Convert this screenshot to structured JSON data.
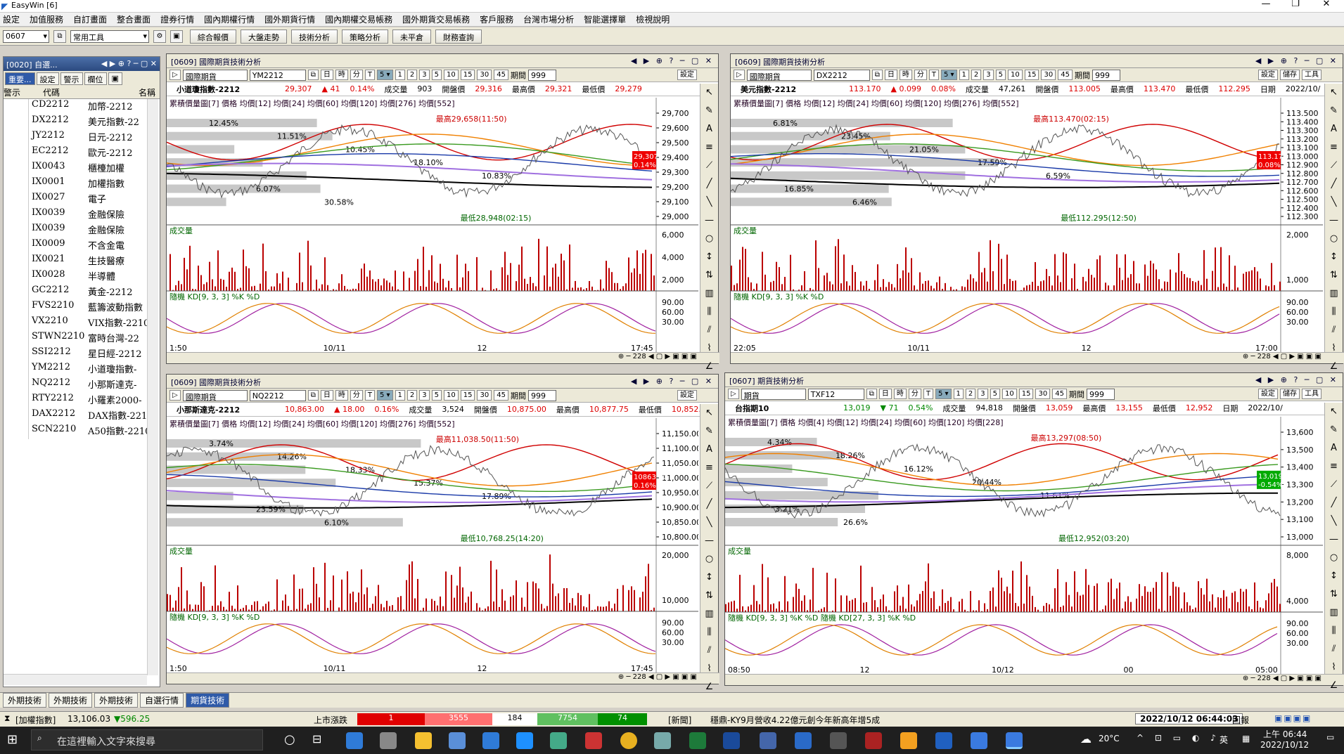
{
  "app": {
    "title": "EasyWin [6]"
  },
  "menu": [
    "設定",
    "加值服務",
    "自訂畫面",
    "整合畫面",
    "證券行情",
    "國內期權行情",
    "國外期貨行情",
    "國內期權交易帳務",
    "國外期貨交易帳務",
    "客戶服務",
    "台灣市場分析",
    "智能選擇單",
    "檢視說明"
  ],
  "toolbar": {
    "code": "0607",
    "layout": "常用工具",
    "buttons": [
      "綜合報價",
      "大盤走勢",
      "技術分析",
      "策略分析",
      "未平倉",
      "財務查詢"
    ]
  },
  "watchlist": {
    "title": "[0020] 自選...",
    "tabs": [
      "重要...",
      "設定",
      "警示",
      "欄位"
    ],
    "cols": [
      "警示",
      "代碼",
      "名稱"
    ],
    "rows": [
      [
        "CD2212",
        "加幣-2212"
      ],
      [
        "DX2212",
        "美元指數-22"
      ],
      [
        "JY2212",
        "日元-2212"
      ],
      [
        "EC2212",
        "歐元-2212"
      ],
      [
        "IX0043",
        "櫃檯加權"
      ],
      [
        "IX0001",
        "加權指數"
      ],
      [
        "IX0027",
        "電子"
      ],
      [
        "IX0039",
        "金融保險"
      ],
      [
        "IX0039",
        "金融保險"
      ],
      [
        "IX0009",
        "不含金電"
      ],
      [
        "IX0021",
        "生技醫療"
      ],
      [
        "IX0028",
        "半導體"
      ],
      [
        "GC2212",
        "黃金-2212"
      ],
      [
        "FVS2210",
        "藍籌波動指數"
      ],
      [
        "VX2210",
        "VIX指數-2210"
      ],
      [
        "STWN2210",
        "富時台灣-22"
      ],
      [
        "SSI2212",
        "星日經-2212"
      ],
      [
        "YM2212",
        "小道瓊指數-"
      ],
      [
        "NQ2212",
        "小那斯達克-"
      ],
      [
        "RTY2212",
        "小羅素2000-"
      ],
      [
        "DAX2212",
        "DAX指數-2212"
      ],
      [
        "SCN2210",
        "A50指數-2210"
      ]
    ]
  },
  "panels": [
    {
      "title": "[0609] 國際期貨技術分析",
      "market": "國際期貨",
      "code": "YM2212",
      "period": "999",
      "name": "小道瓊指數-2212",
      "price": "29,307",
      "chg": "▲ 41",
      "pct": "0.14%",
      "vol_label": "成交量",
      "vol": "903",
      "open_label": "開盤價",
      "open": "29,316",
      "high_label": "最高價",
      "high": "29,321",
      "low_label": "最低價",
      "low": "29,279",
      "legend": "累積價量圖[7] 價格 均價[12] 均價[24] 均價[60] 均價[120] 均價[276] 均價[552]",
      "yticks": [
        "29,700",
        "29,600",
        "29,500",
        "29,400",
        "29,300",
        "29,200",
        "29,100",
        "29,000"
      ],
      "hi": "最高29,658(11:50)",
      "lo": "最低28,948(02:15)",
      "last": "29,307",
      "lastpct": "0.14%",
      "pcts": [
        "12.45%",
        "11.51%",
        "10.45%",
        "18.10%",
        "10.83%",
        "6.07%",
        "30.58%"
      ],
      "volticks": [
        "6,000",
        "4,000",
        "2,000"
      ],
      "kd": "隨機 KD[9, 3, 3] %K %D",
      "kdticks": [
        "90.00",
        "60.00",
        "30.00"
      ],
      "xticks": [
        "1:50",
        "10/11",
        "12",
        "17:45"
      ],
      "zoom": "228"
    },
    {
      "title": "[0609] 國際期貨技術分析",
      "market": "國際期貨",
      "code": "DX2212",
      "period": "999",
      "name": "美元指數-2212",
      "price": "113.170",
      "chg": "▲ 0.099",
      "pct": "0.08%",
      "vol_label": "成交量",
      "vol": "47,261",
      "open_label": "開盤價",
      "open": "113.005",
      "high_label": "最高價",
      "high": "113.470",
      "low_label": "最低價",
      "low": "112.295",
      "legend": "累積價量圖[7] 價格 均價[12] 均價[24] 均價[60] 均價[120] 均價[276] 均價[552]",
      "yticks": [
        "113.500",
        "113.400",
        "113.300",
        "113.200",
        "113.100",
        "113.000",
        "112.900",
        "112.800",
        "112.700",
        "112.600",
        "112.500",
        "112.400",
        "112.300"
      ],
      "hi": "最高113.470(02:15)",
      "lo": "最低112.295(12:50)",
      "last": "113.170",
      "lastpct": "0.08%",
      "pcts": [
        "6.81%",
        "23.45%",
        "21.05%",
        "17.59%",
        "6.59%",
        "16.85%",
        "6.46%"
      ],
      "volticks": [
        "2,000",
        "1,000"
      ],
      "kd": "隨機 KD[9, 3, 3] %K %D",
      "kdticks": [
        "90.00",
        "60.00",
        "30.00"
      ],
      "xticks": [
        "22:05",
        "10/11",
        "12",
        "17:00"
      ],
      "zoom": "228"
    },
    {
      "title": "[0609] 國際期貨技術分析",
      "market": "國際期貨",
      "code": "NQ2212",
      "period": "999",
      "name": "小那斯達克-2212",
      "price": "10,863.00",
      "chg": "▲ 18.00",
      "pct": "0.16%",
      "vol_label": "成交量",
      "vol": "3,524",
      "open_label": "開盤價",
      "open": "10,875.00",
      "high_label": "最高價",
      "high": "10,877.75",
      "low_label": "最低價",
      "low": "10,852.25",
      "legend": "累積價量圖[7] 價格 均價[12] 均價[24] 均價[60] 均價[120] 均價[276] 均價[552]",
      "yticks": [
        "11,150.00",
        "11,100.00",
        "11,050.00",
        "11,000.00",
        "10,950.00",
        "10,900.00",
        "10,850.00",
        "10,800.00"
      ],
      "hi": "最高11,038.50(11:50)",
      "lo": "最低10,768.25(14:20)",
      "last": "10863.00",
      "lastpct": "0.16%",
      "pcts": [
        "3.74%",
        "14.26%",
        "18.33%",
        "15.37%",
        "17.89%",
        "23.59%",
        "6.10%"
      ],
      "volticks": [
        "20,000",
        "10,000"
      ],
      "kd": "隨機 KD[9, 3, 3] %K %D",
      "kdticks": [
        "90.00",
        "60.00",
        "30.00"
      ],
      "xticks": [
        "1:50",
        "10/11",
        "12",
        "17:45"
      ],
      "zoom": "228"
    },
    {
      "title": "[0607] 期貨技術分析",
      "market": "期貨",
      "code": "TXF12",
      "period": "999",
      "name": "台指期10",
      "price": "13,019",
      "chg": "▼ 71",
      "pct": "0.54%",
      "vol_label": "成交量",
      "vol": "94,818",
      "open_label": "開盤價",
      "open": "13,059",
      "high_label": "最高價",
      "high": "13,155",
      "low_label": "最低價",
      "low": "12,952",
      "legend": "累積價量圖[7] 價格 均價[4] 均價[12] 均價[24] 均價[60] 均價[120] 均價[228]",
      "yticks": [
        "13,600",
        "13,500",
        "13,400",
        "13,300",
        "13,200",
        "13,100",
        "13,000"
      ],
      "hi": "最高13,297(08:50)",
      "lo": "最低12,952(03:20)",
      "last": "13,019",
      "lastpct": "-0.54%",
      "pcts": [
        "4.34%",
        "18.26%",
        "16.12%",
        "20.44%",
        "11.61%",
        "3.21%",
        "26.6%"
      ],
      "volticks": [
        "8,000",
        "4,000"
      ],
      "kd": "隨機 KD[9, 3, 3] %K %D 隨機 KD[27, 3, 3] %K %D",
      "kdticks": [
        "90.00",
        "60.00",
        "30.00"
      ],
      "xticks": [
        "08:50",
        "12",
        "10/12",
        "00",
        "05:00"
      ],
      "zoom": "228"
    }
  ],
  "panel_ui": {
    "set": "設定",
    "save": "儲存",
    "tools": "工具",
    "period_label": "期間",
    "date_label": "日期",
    "date_val": "2022/10/",
    "vol_title": "成交量",
    "timeframes": [
      "日",
      "時",
      "分",
      "T"
    ],
    "nums": [
      "1",
      "2",
      "3",
      "5",
      "10",
      "15",
      "30",
      "45"
    ]
  },
  "bottom_tabs": [
    "外期技術",
    "外期技術",
    "外期技術",
    "自選行情",
    "期貨技術"
  ],
  "status": {
    "index_label": "[加權指數]",
    "index": "13,106.03",
    "index_chg": "▼596.25",
    "adv_label": "上市漲跌",
    "b1": "1",
    "b2": "3555",
    "b3": "184",
    "b4": "7754",
    "b5": "74",
    "news_label": "[新聞]",
    "news": "穩鼎-KY9月營收4.22億元創今年新高年增5成",
    "datetime": "2022/10/12 06:44:03",
    "r1": "回報"
  },
  "taskbar": {
    "search": "在這裡輸入文字來搜尋",
    "weather": "20°C",
    "ime": "英",
    "time": "上午 06:44",
    "date": "2022/10/12"
  },
  "colors": {
    "up": "#dd0000",
    "down": "#008800",
    "ma12": "#d00000",
    "ma24": "#f08000",
    "ma60": "#3a9a20",
    "ma120": "#1a3aa8",
    "ma276": "#a070e0",
    "ma552": "#000000"
  }
}
